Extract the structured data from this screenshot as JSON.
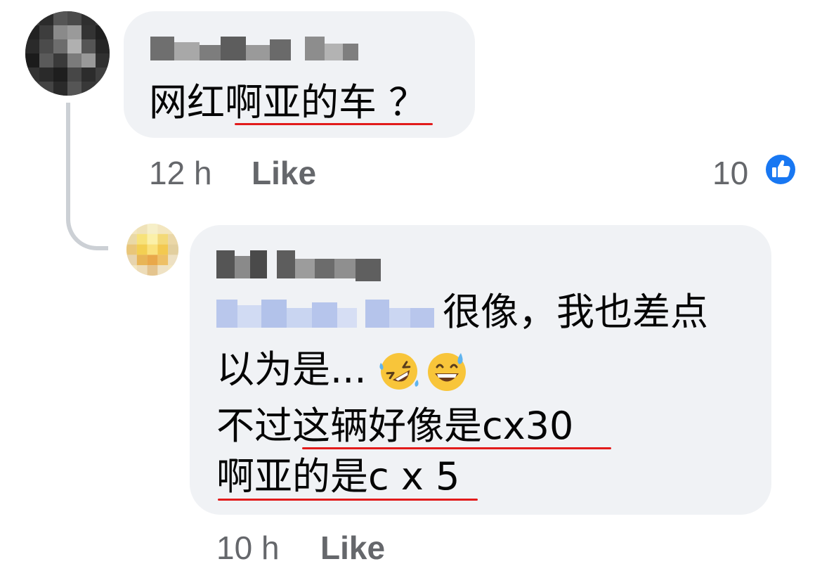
{
  "comment_1": {
    "text_prefix": "网红",
    "text_underlined": "啊亚的车",
    "text_suffix": " ？",
    "time": "12 h",
    "like_label": "Like",
    "reaction_count": "10",
    "reaction_icon": "thumbs-up-icon"
  },
  "reply_1": {
    "line_1_text": "很像，我也差点",
    "line_2_text": "以为是...",
    "line_2_emojis": [
      "rolling-on-floor-laughing-emoji",
      "grinning-sweat-emoji"
    ],
    "line_3_prefix": "不过",
    "line_3_underlined": "这辆好像是cx30",
    "line_4_underlined": "啊亚的是c x 5",
    "time": "10 h",
    "like_label": "Like"
  },
  "colors": {
    "bubble": "#f0f2f5",
    "meta_text": "#65676b",
    "underline": "#e21b1b",
    "like_blue": "#1877f2",
    "thread_line": "#ccd0d5"
  }
}
